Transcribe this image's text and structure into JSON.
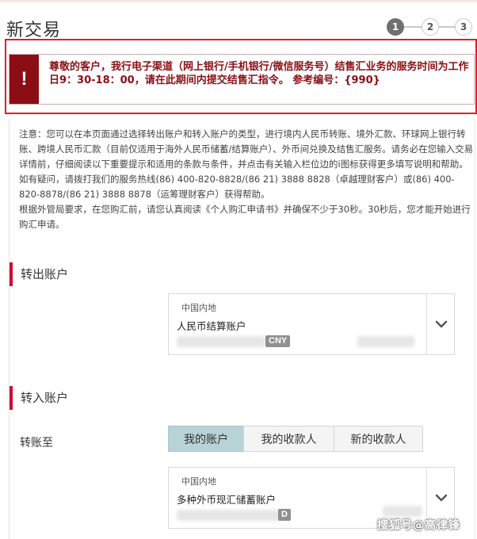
{
  "page": {
    "title": "新交易"
  },
  "steps": [
    "1",
    "2",
    "3"
  ],
  "alert": {
    "icon": "!",
    "text": "尊敬的客户，我行电子渠道（网上银行/手机银行/微信服务号）结售汇业务的服务时间为工作日9：30-18：00，请在此期间内提交结售汇指令。 参考编号：{990}"
  },
  "notice": {
    "paragraph1": "注意：您可以在本页面通过选择转出账户和转入账户的类型，进行境内人民币转账、境外汇款、环球网上银行转账、跨境人民币汇款（目前仅适用于海外人民币储蓄/结算账户）、外币间兑换及结售汇服务。请务必在您输入交易详情前，仔细阅读以下重要提示和适用的条款与条件，并点击有关输入栏位边的i图标获得更多填写说明和帮助。如有疑问，请拨打我们的服务热线(86) 400-820-8828/(86 21) 3888 8828（卓越理财客户）或(86) 400-820-8878/(86 21) 3888 8878（运筹理财客户）获得帮助。",
    "paragraph2": "根据外管局要求，在您购汇前，请您认真阅读《个人购汇申请书》并确保不少于30秒。30秒后，您才能开始进行购汇申请。"
  },
  "from_section": {
    "label": "转出账户",
    "card": {
      "region": "中国内地",
      "account_type": "人民币结算账户",
      "currency": "CNY"
    }
  },
  "to_section": {
    "label": "转入账户",
    "field_label": "转账至",
    "tabs": [
      "我的账户",
      "我的收款人",
      "新的收款人"
    ],
    "active_tab": 0,
    "card": {
      "region": "中国内地",
      "account_type": "多种外币现汇储蓄账户",
      "currency": "D"
    }
  },
  "watermark": "搜狐号@高律锋",
  "colors": {
    "alert_border": "#e51c23",
    "alert_icon_bg": "#8b0e14",
    "section_accent": "#c8102e",
    "active_tab_bg": "#b7d3d6",
    "active_step_bg": "#707070"
  }
}
